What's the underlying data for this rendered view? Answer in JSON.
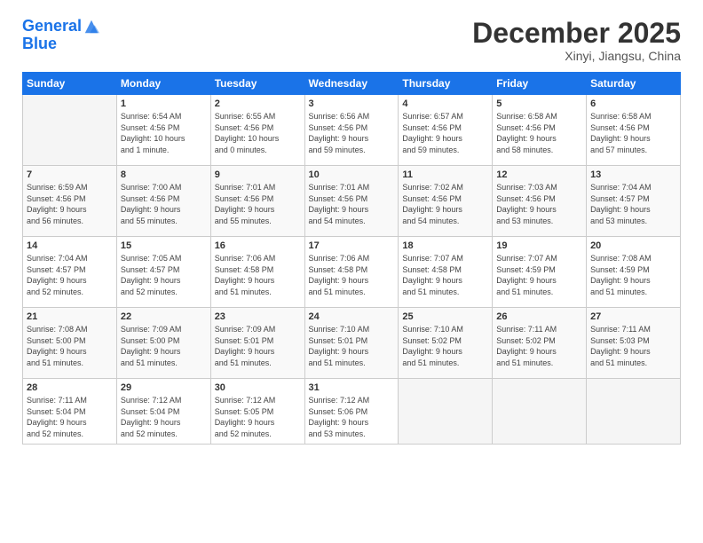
{
  "logo": {
    "line1": "General",
    "line2": "Blue"
  },
  "title": "December 2025",
  "location": "Xinyi, Jiangsu, China",
  "days_header": [
    "Sunday",
    "Monday",
    "Tuesday",
    "Wednesday",
    "Thursday",
    "Friday",
    "Saturday"
  ],
  "weeks": [
    [
      {
        "day": "",
        "info": ""
      },
      {
        "day": "1",
        "info": "Sunrise: 6:54 AM\nSunset: 4:56 PM\nDaylight: 10 hours\nand 1 minute."
      },
      {
        "day": "2",
        "info": "Sunrise: 6:55 AM\nSunset: 4:56 PM\nDaylight: 10 hours\nand 0 minutes."
      },
      {
        "day": "3",
        "info": "Sunrise: 6:56 AM\nSunset: 4:56 PM\nDaylight: 9 hours\nand 59 minutes."
      },
      {
        "day": "4",
        "info": "Sunrise: 6:57 AM\nSunset: 4:56 PM\nDaylight: 9 hours\nand 59 minutes."
      },
      {
        "day": "5",
        "info": "Sunrise: 6:58 AM\nSunset: 4:56 PM\nDaylight: 9 hours\nand 58 minutes."
      },
      {
        "day": "6",
        "info": "Sunrise: 6:58 AM\nSunset: 4:56 PM\nDaylight: 9 hours\nand 57 minutes."
      }
    ],
    [
      {
        "day": "7",
        "info": "Sunrise: 6:59 AM\nSunset: 4:56 PM\nDaylight: 9 hours\nand 56 minutes."
      },
      {
        "day": "8",
        "info": "Sunrise: 7:00 AM\nSunset: 4:56 PM\nDaylight: 9 hours\nand 55 minutes."
      },
      {
        "day": "9",
        "info": "Sunrise: 7:01 AM\nSunset: 4:56 PM\nDaylight: 9 hours\nand 55 minutes."
      },
      {
        "day": "10",
        "info": "Sunrise: 7:01 AM\nSunset: 4:56 PM\nDaylight: 9 hours\nand 54 minutes."
      },
      {
        "day": "11",
        "info": "Sunrise: 7:02 AM\nSunset: 4:56 PM\nDaylight: 9 hours\nand 54 minutes."
      },
      {
        "day": "12",
        "info": "Sunrise: 7:03 AM\nSunset: 4:56 PM\nDaylight: 9 hours\nand 53 minutes."
      },
      {
        "day": "13",
        "info": "Sunrise: 7:04 AM\nSunset: 4:57 PM\nDaylight: 9 hours\nand 53 minutes."
      }
    ],
    [
      {
        "day": "14",
        "info": "Sunrise: 7:04 AM\nSunset: 4:57 PM\nDaylight: 9 hours\nand 52 minutes."
      },
      {
        "day": "15",
        "info": "Sunrise: 7:05 AM\nSunset: 4:57 PM\nDaylight: 9 hours\nand 52 minutes."
      },
      {
        "day": "16",
        "info": "Sunrise: 7:06 AM\nSunset: 4:58 PM\nDaylight: 9 hours\nand 51 minutes."
      },
      {
        "day": "17",
        "info": "Sunrise: 7:06 AM\nSunset: 4:58 PM\nDaylight: 9 hours\nand 51 minutes."
      },
      {
        "day": "18",
        "info": "Sunrise: 7:07 AM\nSunset: 4:58 PM\nDaylight: 9 hours\nand 51 minutes."
      },
      {
        "day": "19",
        "info": "Sunrise: 7:07 AM\nSunset: 4:59 PM\nDaylight: 9 hours\nand 51 minutes."
      },
      {
        "day": "20",
        "info": "Sunrise: 7:08 AM\nSunset: 4:59 PM\nDaylight: 9 hours\nand 51 minutes."
      }
    ],
    [
      {
        "day": "21",
        "info": "Sunrise: 7:08 AM\nSunset: 5:00 PM\nDaylight: 9 hours\nand 51 minutes."
      },
      {
        "day": "22",
        "info": "Sunrise: 7:09 AM\nSunset: 5:00 PM\nDaylight: 9 hours\nand 51 minutes."
      },
      {
        "day": "23",
        "info": "Sunrise: 7:09 AM\nSunset: 5:01 PM\nDaylight: 9 hours\nand 51 minutes."
      },
      {
        "day": "24",
        "info": "Sunrise: 7:10 AM\nSunset: 5:01 PM\nDaylight: 9 hours\nand 51 minutes."
      },
      {
        "day": "25",
        "info": "Sunrise: 7:10 AM\nSunset: 5:02 PM\nDaylight: 9 hours\nand 51 minutes."
      },
      {
        "day": "26",
        "info": "Sunrise: 7:11 AM\nSunset: 5:02 PM\nDaylight: 9 hours\nand 51 minutes."
      },
      {
        "day": "27",
        "info": "Sunrise: 7:11 AM\nSunset: 5:03 PM\nDaylight: 9 hours\nand 51 minutes."
      }
    ],
    [
      {
        "day": "28",
        "info": "Sunrise: 7:11 AM\nSunset: 5:04 PM\nDaylight: 9 hours\nand 52 minutes."
      },
      {
        "day": "29",
        "info": "Sunrise: 7:12 AM\nSunset: 5:04 PM\nDaylight: 9 hours\nand 52 minutes."
      },
      {
        "day": "30",
        "info": "Sunrise: 7:12 AM\nSunset: 5:05 PM\nDaylight: 9 hours\nand 52 minutes."
      },
      {
        "day": "31",
        "info": "Sunrise: 7:12 AM\nSunset: 5:06 PM\nDaylight: 9 hours\nand 53 minutes."
      },
      {
        "day": "",
        "info": ""
      },
      {
        "day": "",
        "info": ""
      },
      {
        "day": "",
        "info": ""
      }
    ]
  ]
}
